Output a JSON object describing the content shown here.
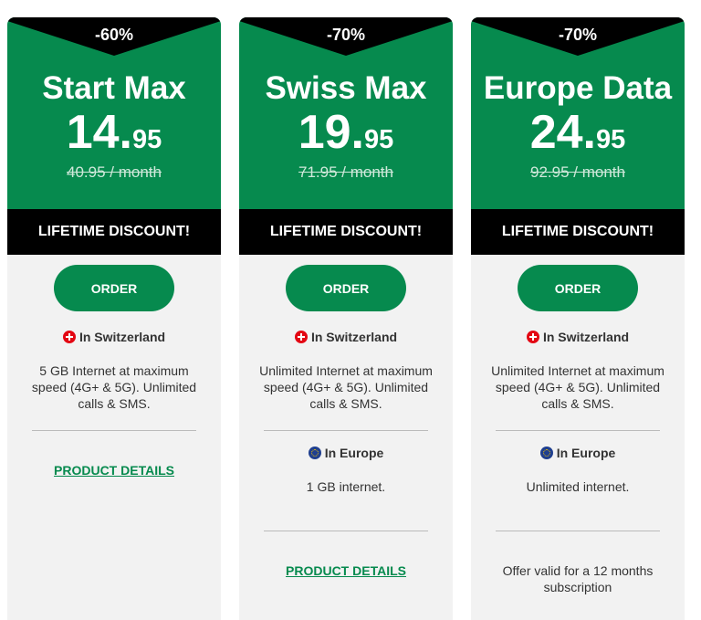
{
  "plans": [
    {
      "discount": "-60%",
      "name": "Start Max",
      "price_int": "14.",
      "price_dec": "95",
      "old_price": "40.95 / month",
      "banner": "LIFETIME DISCOUNT!",
      "order_label": "ORDER",
      "ch_label": "In Switzerland",
      "ch_text": "5 GB Internet at maximum speed (4G+ & 5G). Unlimited calls & SMS.",
      "details_label": "PRODUCT DETAILS"
    },
    {
      "discount": "-70%",
      "name": "Swiss Max",
      "price_int": "19.",
      "price_dec": "95",
      "old_price": "71.95 / month",
      "banner": "LIFETIME DISCOUNT!",
      "order_label": "ORDER",
      "ch_label": "In Switzerland",
      "ch_text": "Unlimited Internet at maximum speed (4G+ & 5G). Unlimited calls & SMS.",
      "eu_label": "In Europe",
      "eu_text": "1 GB internet.",
      "details_label": "PRODUCT DETAILS"
    },
    {
      "discount": "-70%",
      "name": "Europe Data",
      "price_int": "24.",
      "price_dec": "95",
      "old_price": "92.95 / month",
      "banner": "LIFETIME DISCOUNT!",
      "order_label": "ORDER",
      "ch_label": "In Switzerland",
      "ch_text": "Unlimited Internet at maximum speed (4G+ & 5G). Unlimited calls & SMS.",
      "eu_label": "In Europe",
      "eu_text": "Unlimited internet.",
      "offer_text": "Offer valid for a 12 months subscription"
    }
  ],
  "colors": {
    "brand_green": "#068a4e",
    "banner_black": "#000000",
    "card_bg": "#f2f2f2",
    "swiss_red": "#e30613",
    "eu_blue": "#1f3f8f"
  }
}
